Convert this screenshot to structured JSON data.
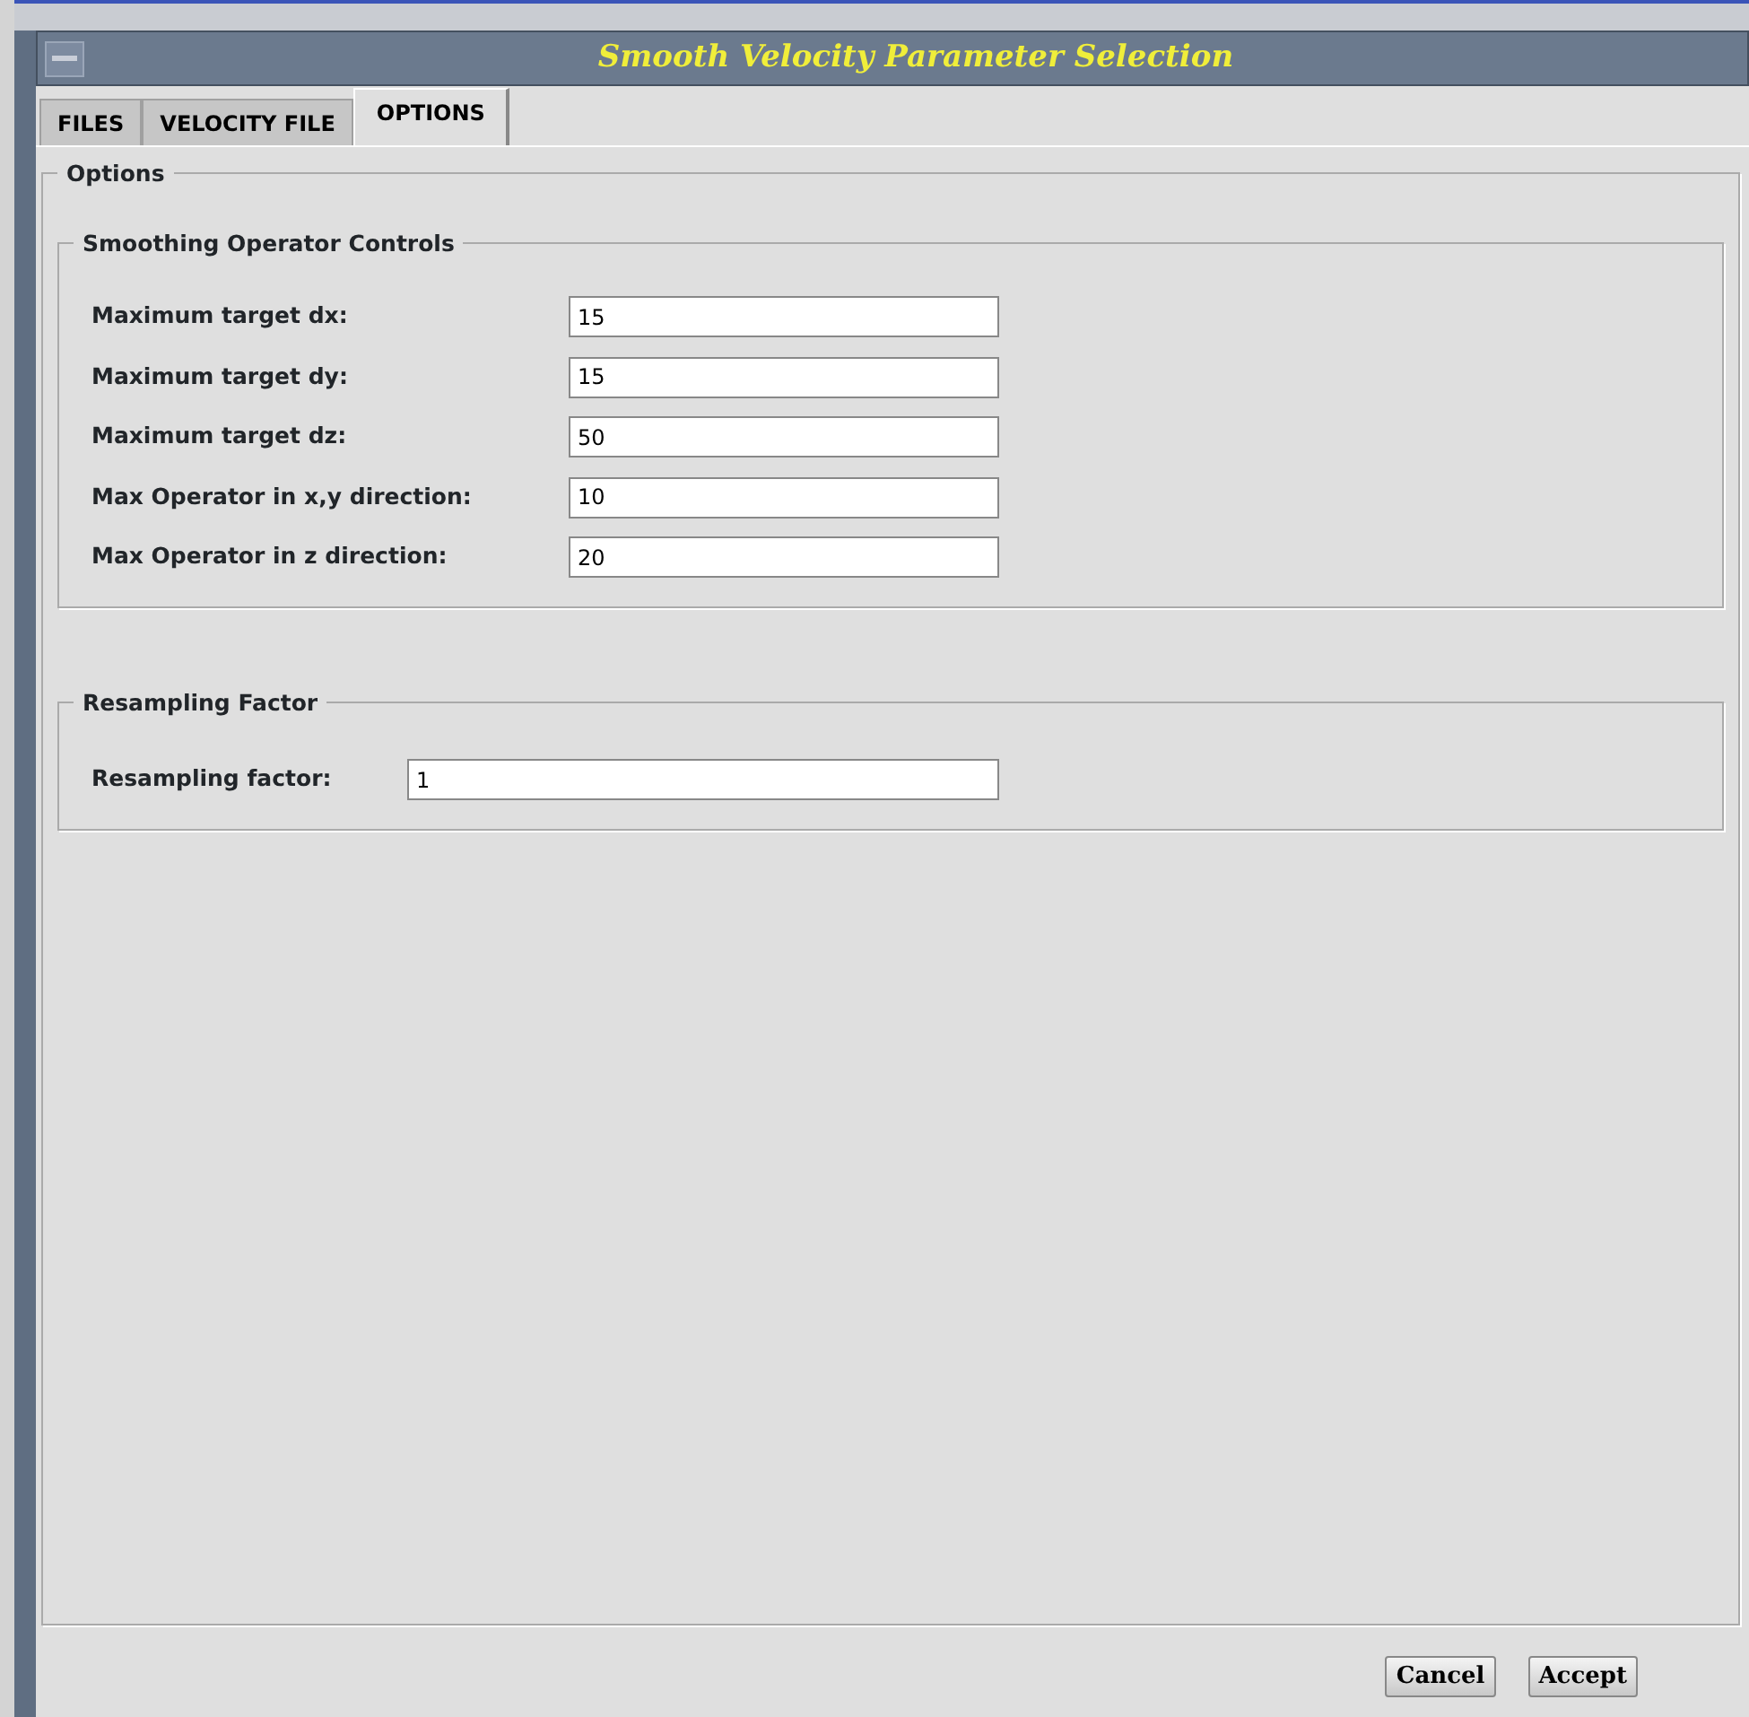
{
  "window": {
    "title": "Smooth Velocity Parameter Selection"
  },
  "tabs": [
    {
      "label": "FILES",
      "selected": false
    },
    {
      "label": "VELOCITY FILE",
      "selected": false
    },
    {
      "label": "OPTIONS",
      "selected": true
    }
  ],
  "panel": {
    "title": "Options",
    "groups": [
      {
        "title": "Smoothing Operator Controls",
        "fields": [
          {
            "label": "Maximum target dx:",
            "value": "15"
          },
          {
            "label": "Maximum target dy:",
            "value": "15"
          },
          {
            "label": "Maximum target dz:",
            "value": "50"
          },
          {
            "label": "Max Operator in x,y direction:",
            "value": "10"
          },
          {
            "label": "Max Operator in z direction:",
            "value": "20"
          }
        ]
      },
      {
        "title": "Resampling Factor",
        "fields": [
          {
            "label": "Resampling factor:",
            "value": "1"
          }
        ]
      }
    ]
  },
  "buttons": [
    "Cancel",
    "Accept"
  ]
}
